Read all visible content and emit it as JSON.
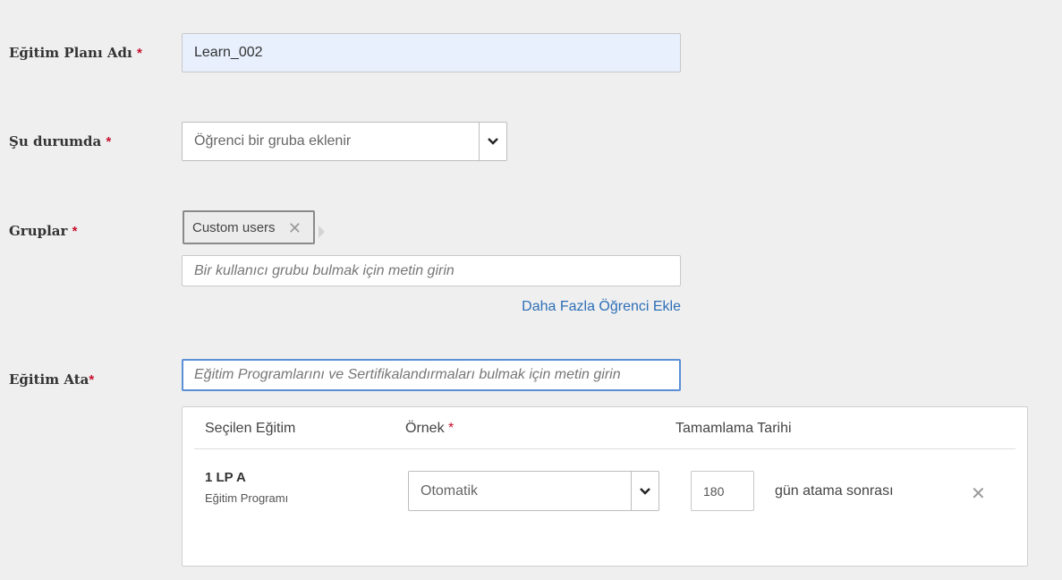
{
  "form": {
    "plan_name": {
      "label": "Eğitim Planı Adı",
      "required_mark": "*",
      "value": "Learn_002"
    },
    "condition": {
      "label": "Şu durumda",
      "required_mark": "*",
      "selected": "Öğrenci bir gruba eklenir"
    },
    "groups": {
      "label": "Gruplar",
      "required_mark": "*",
      "tags": [
        "Custom users"
      ],
      "remove_glyph": "✕",
      "search_placeholder": "Bir kullanıcı grubu bulmak için metin girin",
      "add_more_link": "Daha Fazla Öğrenci Ekle"
    },
    "assign": {
      "label": "Eğitim Ata",
      "required_mark": "*",
      "search_placeholder": "Eğitim Programlarını ve Sertifikalandırmaları bulmak için metin girin"
    }
  },
  "training_table": {
    "headers": {
      "selected": "Seçilen Eğitim",
      "instance": "Örnek",
      "instance_required": "*",
      "completion": "Tamamlama Tarihi"
    },
    "rows": [
      {
        "name": "1 LP A",
        "type": "Eğitim Programı",
        "instance": "Otomatik",
        "days": "180",
        "days_suffix": "gün atama sonrası",
        "remove_glyph": "✕"
      }
    ]
  },
  "icons": {
    "dropdown": "chevron-down-icon",
    "remove": "close-icon"
  },
  "colors": {
    "required": "#c8102e",
    "link": "#2d6fb7",
    "focus_border": "#5b8fd6",
    "filled_input": "#e8f0fe"
  }
}
